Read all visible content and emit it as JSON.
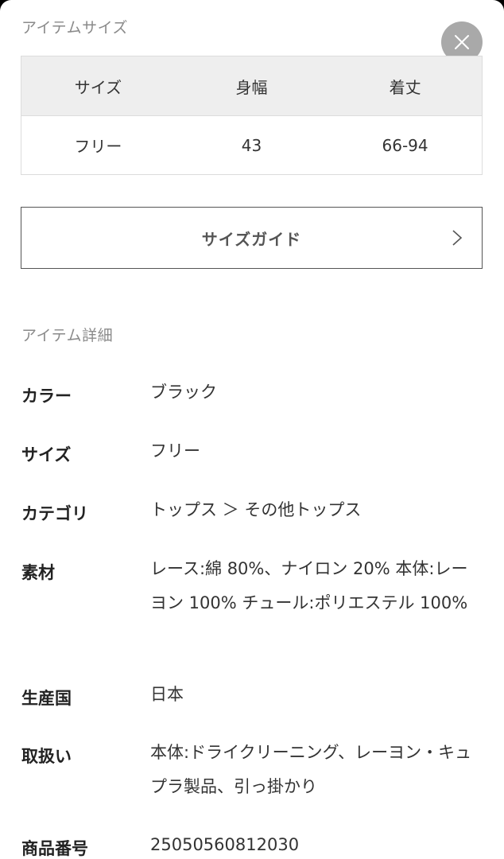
{
  "size_section": {
    "label": "アイテムサイズ",
    "headers": [
      "サイズ",
      "身幅",
      "着丈"
    ],
    "rows": [
      [
        "フリー",
        "43",
        "66-94"
      ]
    ]
  },
  "close_icon": "close-icon",
  "size_guide": {
    "label": "サイズガイド",
    "icon": "chevron-right-icon"
  },
  "detail_section": {
    "label": "アイテム詳細",
    "items": [
      {
        "key": "カラー",
        "value": "ブラック"
      },
      {
        "key": "サイズ",
        "value": "フリー"
      },
      {
        "key": "カテゴリ",
        "value": "トップス ＞ その他トップス"
      },
      {
        "key": "素材",
        "value": "レース:綿 80%、ナイロン 20% 本体:レーヨン 100% チュール:ポリエステル 100%"
      },
      {
        "key": "生産国",
        "value": "日本"
      },
      {
        "key": "取扱い",
        "value": "本体:ドライクリーニング、レーヨン・キュプラ製品、引っ掛かり"
      },
      {
        "key": "商品番号",
        "value": "25050560812030"
      }
    ]
  }
}
